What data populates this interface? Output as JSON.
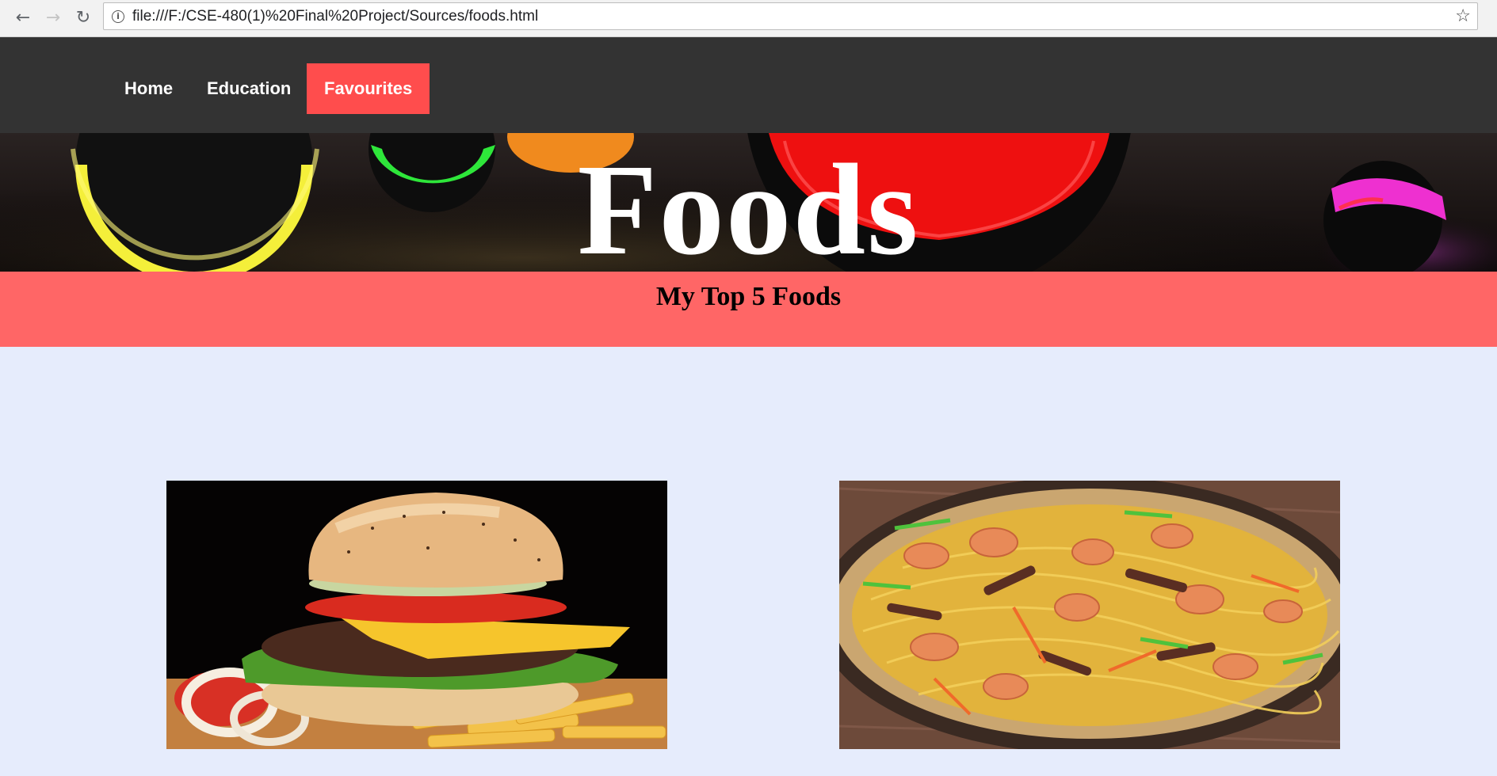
{
  "browser": {
    "url": "file:///F:/CSE-480(1)%20Final%20Project/Sources/foods.html",
    "back_icon": "arrow-left",
    "forward_icon": "arrow-right",
    "reload_icon": "reload",
    "info_icon": "info",
    "bookmark_icon": "star"
  },
  "nav": {
    "items": [
      {
        "label": "Home"
      },
      {
        "label": "Education"
      },
      {
        "label": "Favourites",
        "active": true
      }
    ],
    "active_color": "#ff4d4d"
  },
  "hero": {
    "title": "Foods"
  },
  "section": {
    "title": "My Top 5 Foods",
    "band_color": "#ff6666"
  },
  "foods": [
    {
      "image": "burger-with-fries-photo"
    },
    {
      "image": "shrimp-noodles-photo"
    }
  ],
  "colors": {
    "page_bg": "#e6ecfc",
    "nav_bg": "#333333"
  }
}
